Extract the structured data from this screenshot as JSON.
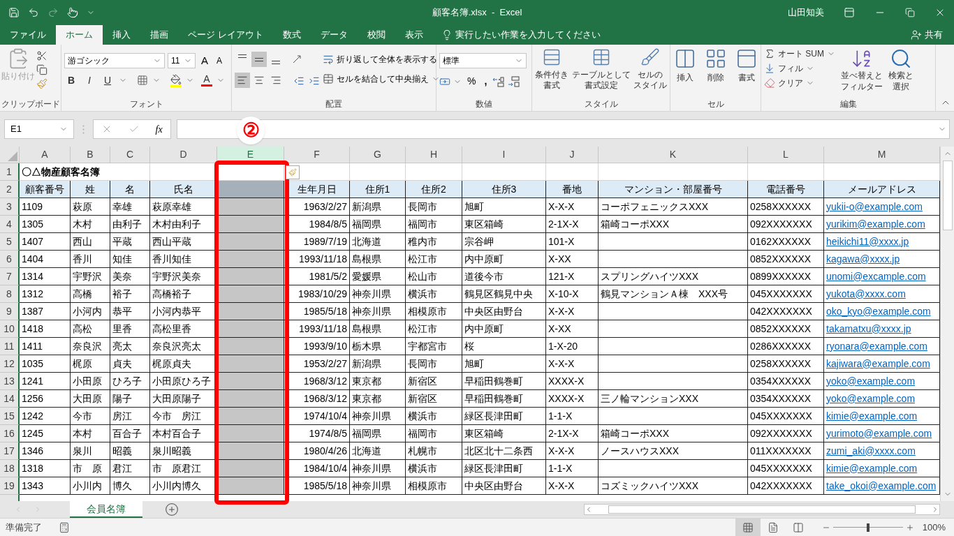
{
  "title_bar": {
    "title": "顧客名簿.xlsx  -  Excel",
    "user": "山田知美"
  },
  "tabs": [
    {
      "label": "ファイル",
      "selected": false
    },
    {
      "label": "ホーム",
      "selected": true
    },
    {
      "label": "挿入",
      "selected": false
    },
    {
      "label": "描画",
      "selected": false
    },
    {
      "label": "ページ レイアウト",
      "selected": false
    },
    {
      "label": "数式",
      "selected": false
    },
    {
      "label": "データ",
      "selected": false
    },
    {
      "label": "校閲",
      "selected": false
    },
    {
      "label": "表示",
      "selected": false
    }
  ],
  "tell_me": "実行したい作業を入力してください",
  "share": "共有",
  "ribbon": {
    "clipboard": {
      "label": "クリップボード",
      "paste": {
        "label": "貼り付け",
        "disabled": true
      }
    },
    "font": {
      "label": "フォント",
      "font_name": "游ゴシック",
      "font_size": "11",
      "grow": "A",
      "shrink": "A",
      "bold": "B",
      "italic": "I",
      "underline": "U",
      "font_color": "A"
    },
    "alignment": {
      "label": "配置",
      "wrap_text": "折り返して全体を表示する",
      "merge": "セルを結合して中央揃え",
      "vertical": [
        {
          "kind": "top",
          "selected": false
        },
        {
          "kind": "middle",
          "selected": true
        },
        {
          "kind": "bottom",
          "selected": false
        }
      ],
      "horizontal": [
        {
          "kind": "left",
          "selected": true
        },
        {
          "kind": "center",
          "selected": false
        },
        {
          "kind": "right",
          "selected": false
        }
      ]
    },
    "number": {
      "label": "数値",
      "format": "標準",
      "percent": "%",
      "comma": ","
    },
    "styles": {
      "label": "スタイル",
      "items": [
        {
          "kind": "conditional",
          "lines": [
            "条件付き",
            "書式"
          ]
        },
        {
          "kind": "table",
          "lines": [
            "テーブルとして",
            "書式設定"
          ]
        },
        {
          "kind": "cell_style",
          "lines": [
            "セルの",
            "スタイル"
          ]
        }
      ]
    },
    "cells": {
      "label": "セル",
      "items": [
        {
          "kind": "insert",
          "label": "挿入"
        },
        {
          "kind": "delete",
          "label": "削除"
        },
        {
          "kind": "format",
          "label": "書式"
        }
      ]
    },
    "editing": {
      "label": "編集",
      "autosum": "オート SUM",
      "fill": "フィル",
      "clear": "クリア",
      "sort": [
        "並べ替えと",
        "フィルター"
      ],
      "find": [
        "検索と",
        "選択"
      ]
    }
  },
  "formula_bar": {
    "name_box": "E1",
    "fx": "fx"
  },
  "annotation": {
    "marker": "②"
  },
  "columns": [
    {
      "letter": "A",
      "selected": false,
      "kind": "text"
    },
    {
      "letter": "B",
      "selected": false,
      "kind": "text"
    },
    {
      "letter": "C",
      "selected": false,
      "kind": "text"
    },
    {
      "letter": "D",
      "selected": false,
      "kind": "text"
    },
    {
      "letter": "E",
      "selected": true,
      "kind": "text"
    },
    {
      "letter": "F",
      "selected": false,
      "kind": "date"
    },
    {
      "letter": "G",
      "selected": false,
      "kind": "text"
    },
    {
      "letter": "H",
      "selected": false,
      "kind": "text"
    },
    {
      "letter": "I",
      "selected": false,
      "kind": "text"
    },
    {
      "letter": "J",
      "selected": false,
      "kind": "text"
    },
    {
      "letter": "K",
      "selected": false,
      "kind": "text"
    },
    {
      "letter": "L",
      "selected": false,
      "kind": "text"
    },
    {
      "letter": "M",
      "selected": false,
      "kind": "link"
    }
  ],
  "rows": [
    {
      "number": "1",
      "kind": "title",
      "cells": [
        "〇△物産顧客名簿",
        null,
        null,
        null,
        null,
        null,
        null,
        null,
        null,
        null,
        null,
        null,
        null
      ]
    },
    {
      "number": "2",
      "kind": "header",
      "cells": [
        "顧客番号",
        "姓",
        "名",
        "氏名",
        null,
        "生年月日",
        "住所1",
        "住所2",
        "住所3",
        "番地",
        "マンション・部屋番号",
        "電話番号",
        "メールアドレス"
      ]
    },
    {
      "number": "3",
      "kind": "data",
      "cells": [
        "1109",
        "萩原",
        "幸雄",
        "萩原幸雄",
        null,
        "1963/2/27",
        "新潟県",
        "長岡市",
        "旭町",
        "X-X-X",
        "コーポフェニックスXXX",
        "0258XXXXXX",
        "yukii-o@example.com"
      ]
    },
    {
      "number": "4",
      "kind": "data",
      "cells": [
        "1305",
        "木村",
        "由利子",
        "木村由利子",
        null,
        "1984/8/5",
        "福岡県",
        "福岡市",
        "東区箱崎",
        "2-1X-X",
        "箱崎コーポXXX",
        "092XXXXXXX",
        "yurikim@example.com"
      ]
    },
    {
      "number": "5",
      "kind": "data",
      "cells": [
        "1407",
        "西山",
        "平蔵",
        "西山平蔵",
        null,
        "1989/7/19",
        "北海道",
        "稚内市",
        "宗谷岬",
        "101-X",
        null,
        "0162XXXXXX",
        "heikichi11@xxxx.jp"
      ]
    },
    {
      "number": "6",
      "kind": "data",
      "cells": [
        "1404",
        "香川",
        "知佳",
        "香川知佳",
        null,
        "1993/11/18",
        "島根県",
        "松江市",
        "内中原町",
        "X-XX",
        null,
        "0852XXXXXX",
        "kagawa@xxxx.jp"
      ]
    },
    {
      "number": "7",
      "kind": "data",
      "cells": [
        "1314",
        "宇野沢",
        "美奈",
        "宇野沢美奈",
        null,
        "1981/5/2",
        "愛媛県",
        "松山市",
        "道後今市",
        "121-X",
        "スプリングハイツXXX",
        "0899XXXXXX",
        "unomi@excample.com"
      ]
    },
    {
      "number": "8",
      "kind": "data",
      "cells": [
        "1312",
        "高橋",
        "裕子",
        "高橋裕子",
        null,
        "1983/10/29",
        "神奈川県",
        "横浜市",
        "鶴見区鶴見中央",
        "X-10-X",
        "鶴見マンションＡ棟　XXX号",
        "045XXXXXXX",
        "yukota@xxxx.com"
      ]
    },
    {
      "number": "9",
      "kind": "data",
      "cells": [
        "1387",
        "小河内",
        "恭平",
        "小河内恭平",
        null,
        "1985/5/18",
        "神奈川県",
        "相模原市",
        "中央区由野台",
        "X-X-X",
        null,
        "042XXXXXXX",
        "oko_kyo@example.com"
      ]
    },
    {
      "number": "10",
      "kind": "data",
      "cells": [
        "1418",
        "高松",
        "里香",
        "高松里香",
        null,
        "1993/11/18",
        "島根県",
        "松江市",
        "内中原町",
        "X-XX",
        null,
        "0852XXXXXX",
        "takamatxu@xxxx.jp"
      ]
    },
    {
      "number": "11",
      "kind": "data",
      "cells": [
        "1411",
        "奈良沢",
        "亮太",
        "奈良沢亮太",
        null,
        "1993/9/10",
        "栃木県",
        "宇都宮市",
        "桜",
        "1-X-20",
        null,
        "0286XXXXXX",
        "ryonara@example.com"
      ]
    },
    {
      "number": "12",
      "kind": "data",
      "cells": [
        "1035",
        "梶原",
        "貞夫",
        "梶原貞夫",
        null,
        "1953/2/27",
        "新潟県",
        "長岡市",
        "旭町",
        "X-X-X",
        null,
        "0258XXXXXX",
        "kajiwara@example.com"
      ]
    },
    {
      "number": "13",
      "kind": "data",
      "cells": [
        "1241",
        "小田原",
        "ひろ子",
        "小田原ひろ子",
        null,
        "1968/3/12",
        "東京都",
        "新宿区",
        "早稲田鶴巻町",
        "XXXX-X",
        null,
        "0354XXXXXX",
        "yoko@example.com"
      ]
    },
    {
      "number": "14",
      "kind": "data",
      "cells": [
        "1256",
        "大田原",
        "陽子",
        "大田原陽子",
        null,
        "1968/3/12",
        "東京都",
        "新宿区",
        "早稲田鶴巻町",
        "XXXX-X",
        "三ノ輪マンションXXX",
        "0354XXXXXX",
        "yoko@example.com"
      ]
    },
    {
      "number": "15",
      "kind": "data",
      "cells": [
        "1242",
        "今市",
        "房江",
        "今市　房江",
        null,
        "1974/10/4",
        "神奈川県",
        "横浜市",
        "緑区長津田町",
        "1-1-X",
        null,
        "045XXXXXXX",
        "kimie@example.com"
      ]
    },
    {
      "number": "16",
      "kind": "data",
      "cells": [
        "1245",
        "本村",
        "百合子",
        "本村百合子",
        null,
        "1974/8/5",
        "福岡県",
        "福岡市",
        "東区箱崎",
        "2-1X-X",
        "箱崎コーポXXX",
        "092XXXXXXX",
        "yurimoto@example.com"
      ]
    },
    {
      "number": "17",
      "kind": "data",
      "cells": [
        "1346",
        "泉川",
        "昭義",
        "泉川昭義",
        null,
        "1980/4/26",
        "北海道",
        "札幌市",
        "北区北十二条西",
        "X-X-X",
        "ノースハウスXXX",
        "011XXXXXXX",
        "zumi_aki@xxxx.com"
      ]
    },
    {
      "number": "18",
      "kind": "data",
      "cells": [
        "1318",
        "市　原",
        "君江",
        "市　原君江",
        null,
        "1984/10/4",
        "神奈川県",
        "横浜市",
        "緑区長津田町",
        "1-1-X",
        null,
        "045XXXXXXX",
        "kimie@example.com"
      ]
    },
    {
      "number": "19",
      "kind": "data",
      "cells": [
        "1343",
        "小川内",
        "博久",
        "小川内博久",
        null,
        "1985/5/18",
        "神奈川県",
        "相模原市",
        "中央区由野台",
        "X-X-X",
        "コズミックハイツXXX",
        "042XXXXXXX",
        "take_okoi@example.com"
      ]
    }
  ],
  "sheet_tabs": [
    {
      "label": "会員名簿",
      "selected": true
    }
  ],
  "status_bar": {
    "status": "準備完了",
    "views": [
      {
        "kind": "normal",
        "selected": true
      },
      {
        "kind": "page_layout",
        "selected": false
      },
      {
        "kind": "page_break",
        "selected": false
      }
    ],
    "zoom": {
      "level": 0.5,
      "label": "100%"
    }
  }
}
